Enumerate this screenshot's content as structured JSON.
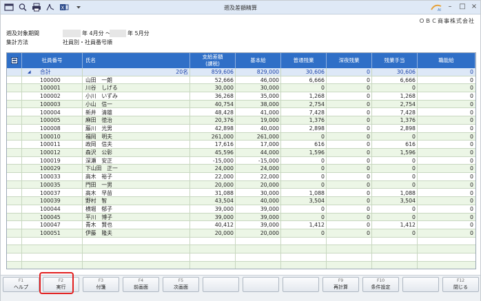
{
  "window": {
    "title": "遡及差額精算",
    "company": "ＯＢＣ商事株式会社"
  },
  "conditions": {
    "period_label": "遡及対象期間",
    "period_from": "年 4月分 ～",
    "period_to": "年 5月分",
    "method_label": "集計方法",
    "method_value": "社員別・社員番号順"
  },
  "table": {
    "headers": [
      "社員番号",
      "氏名",
      "支給差額\n(課税)",
      "基本給",
      "普通残業",
      "深夜残業",
      "残業手当",
      "職能給"
    ],
    "total": {
      "label": "合計",
      "count": "20名",
      "values": [
        "859,606",
        "829,000",
        "30,606",
        "0",
        "30,606",
        "0"
      ]
    },
    "rows": [
      [
        "100000",
        "山田　一朗",
        "52,666",
        "46,000",
        "6,666",
        "0",
        "6,666",
        "0"
      ],
      [
        "100001",
        "川谷　しげる",
        "30,000",
        "30,000",
        "0",
        "0",
        "0",
        "0"
      ],
      [
        "100002",
        "小川　いずみ",
        "36,268",
        "35,000",
        "1,268",
        "0",
        "1,268",
        "0"
      ],
      [
        "100003",
        "小山　信一",
        "40,754",
        "38,000",
        "2,754",
        "0",
        "2,754",
        "0"
      ],
      [
        "100004",
        "新井　清雄",
        "48,428",
        "41,000",
        "7,428",
        "0",
        "7,428",
        "0"
      ],
      [
        "100005",
        "麻田　徳治",
        "20,376",
        "19,000",
        "1,376",
        "0",
        "1,376",
        "0"
      ],
      [
        "100008",
        "藤川　光男",
        "42,898",
        "40,000",
        "2,898",
        "0",
        "2,898",
        "0"
      ],
      [
        "100010",
        "福岡　明夫",
        "261,000",
        "261,000",
        "0",
        "0",
        "0",
        "0"
      ],
      [
        "100011",
        "政岡　信夫",
        "17,616",
        "17,000",
        "616",
        "0",
        "616",
        "0"
      ],
      [
        "100012",
        "森沢　公彰",
        "45,596",
        "44,000",
        "1,596",
        "0",
        "1,596",
        "0"
      ],
      [
        "100019",
        "深瀬　安正",
        "-15,000",
        "-15,000",
        "0",
        "0",
        "0",
        "0"
      ],
      [
        "100029",
        "下山田　正一",
        "24,000",
        "24,000",
        "0",
        "0",
        "0",
        "0"
      ],
      [
        "100033",
        "高木　裕子",
        "22,000",
        "22,000",
        "0",
        "0",
        "0",
        "0"
      ],
      [
        "100035",
        "門田　一男",
        "20,000",
        "20,000",
        "0",
        "0",
        "0",
        "0"
      ],
      [
        "100037",
        "高木　早苗",
        "31,088",
        "30,000",
        "1,088",
        "0",
        "1,088",
        "0"
      ],
      [
        "100039",
        "野村　智",
        "43,504",
        "40,000",
        "3,504",
        "0",
        "3,504",
        "0"
      ],
      [
        "100044",
        "横堀　郁子",
        "39,000",
        "39,000",
        "0",
        "0",
        "0",
        "0"
      ],
      [
        "100045",
        "平川　博子",
        "39,000",
        "39,000",
        "0",
        "0",
        "0",
        "0"
      ],
      [
        "100047",
        "青木　賢也",
        "40,412",
        "39,000",
        "1,412",
        "0",
        "1,412",
        "0"
      ],
      [
        "100051",
        "伊藤　隆夫",
        "20,000",
        "20,000",
        "0",
        "0",
        "0",
        "0"
      ]
    ]
  },
  "fkeys": [
    {
      "key": "F1",
      "label": "ヘルプ"
    },
    {
      "key": "F2",
      "label": "実行"
    },
    {
      "key": "F3",
      "label": "付箋"
    },
    {
      "key": "F4",
      "label": "前画面"
    },
    {
      "key": "F5",
      "label": "次画面"
    },
    {
      "key": "",
      "label": ""
    },
    {
      "key": "",
      "label": ""
    },
    {
      "key": "",
      "label": ""
    },
    {
      "key": "F9",
      "label": "再計算"
    },
    {
      "key": "F10",
      "label": "条件設定"
    },
    {
      "key": "",
      "label": ""
    },
    {
      "key": "F12",
      "label": "閉じる"
    }
  ],
  "colors": {
    "header": "#2f6fc7",
    "row_alt": "#ecf6e6",
    "total": "#dde8f7",
    "highlight": "#e21e1e"
  }
}
